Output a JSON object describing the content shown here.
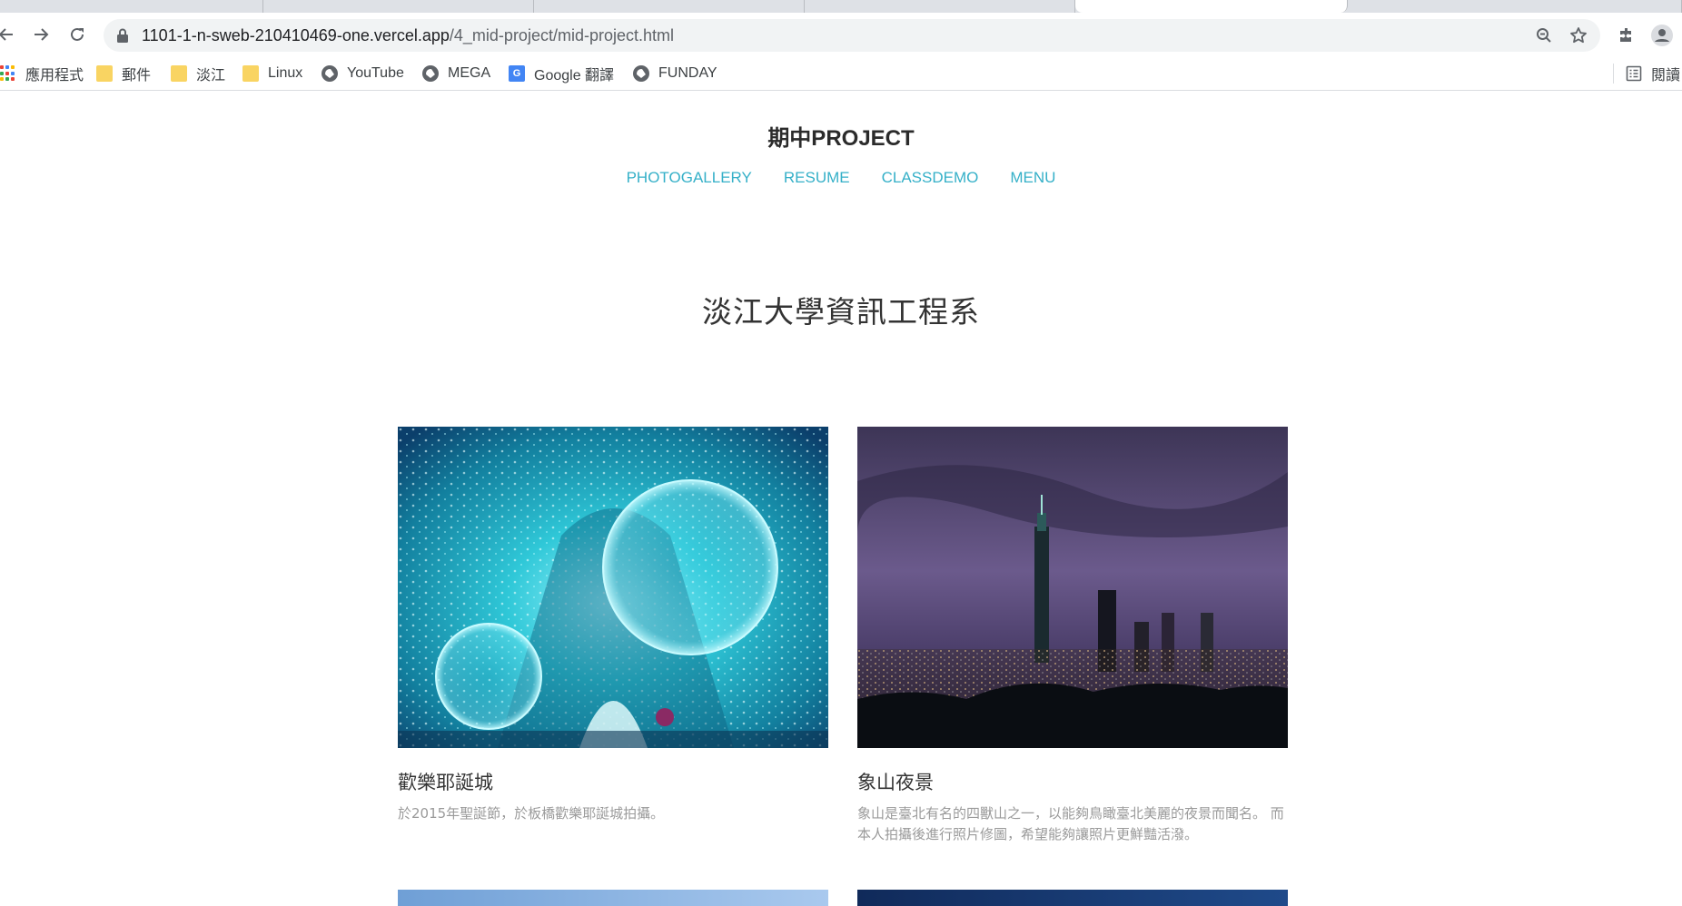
{
  "browser": {
    "url_host": "1101-1-n-sweb-210410469-one.vercel.app",
    "url_path": "/4_mid-project/mid-project.html"
  },
  "bookmarks": {
    "items": [
      {
        "label": "應用程式",
        "icon": "apps-icon"
      },
      {
        "label": "郵件",
        "icon": "folder-icon"
      },
      {
        "label": "淡江",
        "icon": "folder-icon"
      },
      {
        "label": "Linux",
        "icon": "folder-icon"
      },
      {
        "label": "YouTube",
        "icon": "globe-icon"
      },
      {
        "label": "MEGA",
        "icon": "globe-icon"
      },
      {
        "label": "Google 翻譯",
        "icon": "google-translate-icon"
      },
      {
        "label": "FUNDAY",
        "icon": "globe-icon"
      }
    ],
    "reading_list_label": "閱讀"
  },
  "site": {
    "title": "期中PROJECT",
    "nav": [
      "PHOTOGALLERY",
      "RESUME",
      "CLASSDEMO",
      "MENU"
    ],
    "section_heading": "淡江大學資訊工程系"
  },
  "gallery": [
    {
      "title": "歡樂耶誕城",
      "description": "於2015年聖誕節，於板橋歡樂耶誕城拍攝。"
    },
    {
      "title": "象山夜景",
      "description": "象山是臺北有名的四獸山之一，以能夠鳥瞰臺北美麗的夜景而聞名。 而本人拍攝後進行照片修圖，希望能夠讓照片更鮮豔活潑。"
    }
  ],
  "colors": {
    "nav_link": "#35b0c8",
    "chrome_bg": "#dee1e6",
    "omnibox_bg": "#f1f3f4"
  }
}
